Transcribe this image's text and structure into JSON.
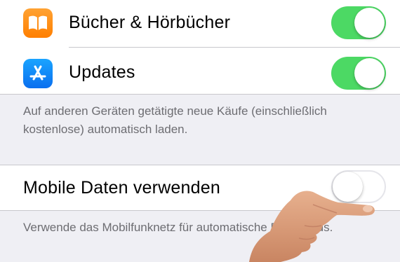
{
  "downloads": {
    "items": [
      {
        "label": "Bücher & Hörbücher",
        "icon": "books-icon",
        "icon_color": "#ff8a00",
        "enabled": true
      },
      {
        "label": "Updates",
        "icon": "app-store-icon",
        "icon_color": "#1a8cff",
        "enabled": true
      }
    ],
    "footer": "Auf anderen Geräten getätigte neue Käufe (einschließlich kostenlose) automatisch laden."
  },
  "mobile_data": {
    "label": "Mobile Daten verwenden",
    "enabled": false,
    "footer": "Verwende das Mobilfunknetz für automatische Downloads."
  },
  "colors": {
    "toggle_on": "#4cd964",
    "background": "#efeff4",
    "footer_text": "#6d6d72"
  }
}
